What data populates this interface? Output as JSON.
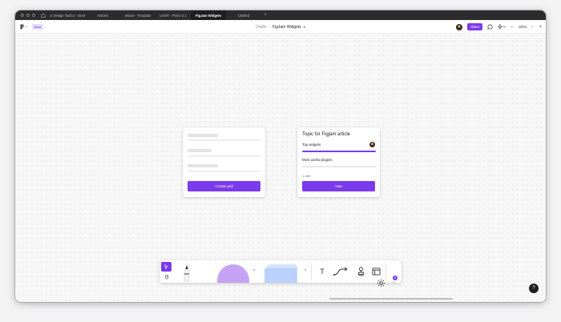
{
  "tabs": [
    {
      "label": "UI Design Tactics - Book",
      "active": false
    },
    {
      "label": "Articles",
      "active": false
    },
    {
      "label": "eBook - Template",
      "active": false
    },
    {
      "label": "UXMT - Prime 3.1",
      "active": false
    },
    {
      "label": "FigJam Widgets",
      "active": true
    },
    {
      "label": "Untitled",
      "active": false
    }
  ],
  "new_tab_label": "+",
  "header": {
    "beta_label": "Beta",
    "breadcrumb_parent": "Drafts",
    "breadcrumb_sep": "/",
    "file_name": "FigJam Widgets",
    "share_label": "Share",
    "zoom_level": "100%",
    "zoom_out": "−",
    "zoom_in": "+"
  },
  "poll_setup": {
    "button_label": "Create poll"
  },
  "poll": {
    "title": "Topic for Figjam article",
    "options": [
      {
        "label": "Top widgets",
        "fraction": 1.0
      },
      {
        "label": "Most useful plugins",
        "fraction": 0.0
      }
    ],
    "vote_count": "1 vote",
    "button_label": "Vote"
  },
  "toolbar": {
    "select_icon": "cursor-icon",
    "hand_icon": "hand-icon",
    "text_tool": "T",
    "more_label": "···",
    "badge_count": "8",
    "accent": "#7c3aed",
    "shape_color": "#c6a3f4",
    "sticky_color": "#b9d1fb"
  },
  "help_label": "?"
}
